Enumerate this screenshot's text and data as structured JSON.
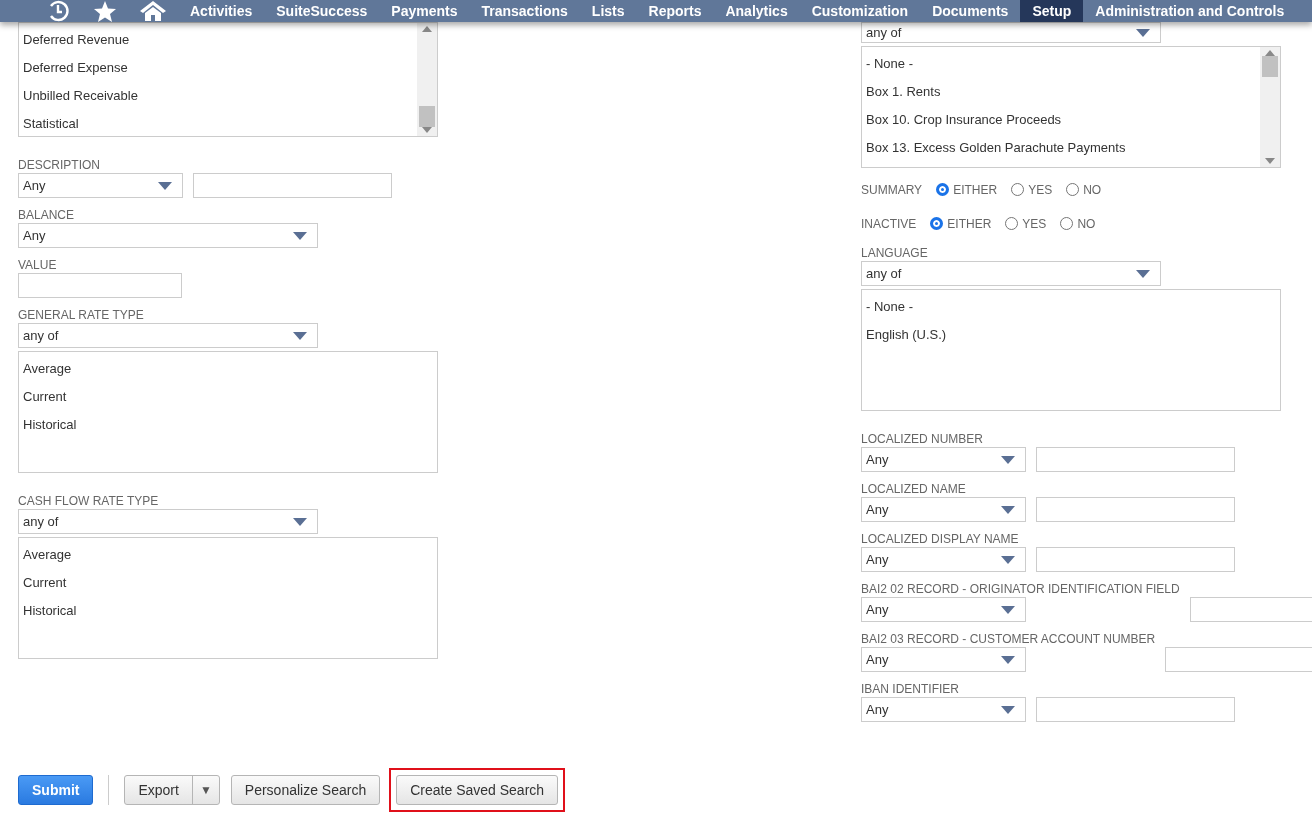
{
  "nav": {
    "items": [
      {
        "kind": "clock"
      },
      {
        "kind": "star"
      },
      {
        "kind": "home"
      },
      {
        "kind": "text",
        "label": "Activities",
        "selected": false
      },
      {
        "kind": "text",
        "label": "SuiteSuccess",
        "selected": false
      },
      {
        "kind": "text",
        "label": "Payments",
        "selected": false
      },
      {
        "kind": "text",
        "label": "Transactions",
        "selected": false
      },
      {
        "kind": "text",
        "label": "Lists",
        "selected": false
      },
      {
        "kind": "text",
        "label": "Reports",
        "selected": false
      },
      {
        "kind": "text",
        "label": "Analytics",
        "selected": false
      },
      {
        "kind": "text",
        "label": "Customization",
        "selected": false
      },
      {
        "kind": "text",
        "label": "Documents",
        "selected": false
      },
      {
        "kind": "text",
        "label": "Setup",
        "selected": true
      },
      {
        "kind": "text",
        "label": "Administration and Controls",
        "selected": false
      }
    ]
  },
  "left_fields": [
    {
      "kind": "listbox",
      "options": [
        "Deferred Revenue",
        "Deferred Expense",
        "Unbilled Receivable",
        "Statistical"
      ],
      "scrolled_to_end": true
    },
    {
      "kind": "select-text",
      "label": "DESCRIPTION",
      "value": "Any"
    },
    {
      "kind": "select",
      "label": "BALANCE",
      "value": "Any"
    },
    {
      "kind": "text",
      "label": "VALUE"
    },
    {
      "kind": "multiselect",
      "label": "GENERAL RATE TYPE",
      "value": "any of",
      "options": [
        "Average",
        "Current",
        "Historical"
      ]
    },
    {
      "kind": "multiselect",
      "label": "CASH FLOW RATE TYPE",
      "value": "any of",
      "options": [
        "Average",
        "Current",
        "Historical"
      ]
    }
  ],
  "right_fields": [
    {
      "kind": "multiselect",
      "value": "any of",
      "options": [
        "- None -",
        "Box 1. Rents",
        "Box 10. Crop Insurance Proceeds",
        "Box 13. Excess Golden Parachute Payments"
      ],
      "scrolled_to_end": false
    },
    {
      "kind": "radios",
      "label": "SUMMARY",
      "options": [
        {
          "label": "EITHER",
          "selected": true
        },
        {
          "label": "YES",
          "selected": false
        },
        {
          "label": "NO",
          "selected": false
        }
      ]
    },
    {
      "kind": "radios",
      "label": "INACTIVE",
      "options": [
        {
          "label": "EITHER",
          "selected": true
        },
        {
          "label": "YES",
          "selected": false
        },
        {
          "label": "NO",
          "selected": false
        }
      ]
    },
    {
      "kind": "multiselect",
      "label": "LANGUAGE",
      "value": "any of",
      "options": [
        "- None -",
        "English (U.S.)"
      ]
    },
    {
      "kind": "select-text",
      "label": "LOCALIZED NUMBER",
      "value": "Any"
    },
    {
      "kind": "select-text",
      "label": "LOCALIZED NAME",
      "value": "Any"
    },
    {
      "kind": "select-text",
      "label": "LOCALIZED DISPLAY NAME",
      "value": "Any"
    },
    {
      "kind": "select-text",
      "label": "BAI2 02 RECORD - ORIGINATOR IDENTIFICATION FIELD",
      "value": "Any"
    },
    {
      "kind": "select-text",
      "label": "BAI2 03 RECORD - CUSTOMER ACCOUNT NUMBER",
      "value": "Any"
    },
    {
      "kind": "select-text",
      "label": "IBAN IDENTIFIER",
      "value": "Any"
    }
  ],
  "buttons": [
    {
      "kind": "primary",
      "label": "Submit",
      "highlighted": false
    },
    {
      "kind": "split",
      "label": "Export",
      "menu": "▼",
      "highlighted": false
    },
    {
      "kind": "secondary",
      "label": "Personalize Search",
      "highlighted": false
    },
    {
      "kind": "secondary",
      "label": "Create Saved Search",
      "highlighted": true
    }
  ]
}
